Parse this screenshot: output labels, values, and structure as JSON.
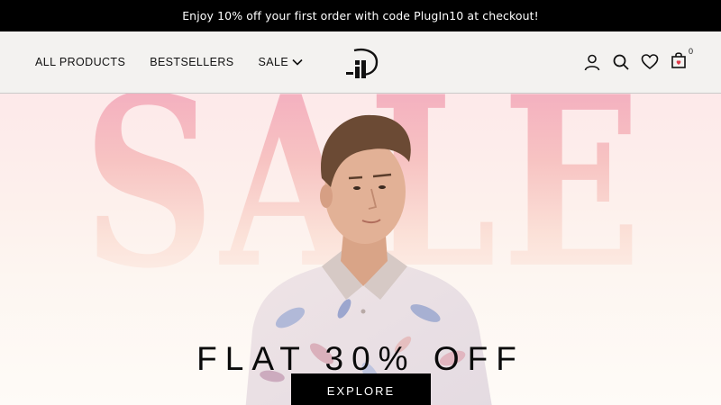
{
  "announcement": {
    "text": "Enjoy 10% off your first order with code PlugIn10 at checkout!"
  },
  "nav": {
    "items": [
      {
        "label": "ALL PRODUCTS"
      },
      {
        "label": "BESTSELLERS"
      },
      {
        "label": "SALE",
        "has_dropdown": true
      }
    ]
  },
  "header_icons": [
    "user-icon",
    "search-icon",
    "heart-icon",
    "cart-icon"
  ],
  "cart": {
    "count": "0"
  },
  "hero": {
    "background_word": "SALE",
    "headline": "FLAT 30% OFF",
    "cta_label": "EXPLORE"
  },
  "colors": {
    "announcement_bg": "#000000",
    "header_bg": "#f3f2f0",
    "hero_pink": "#f3a9bf",
    "button_bg": "#000000"
  }
}
